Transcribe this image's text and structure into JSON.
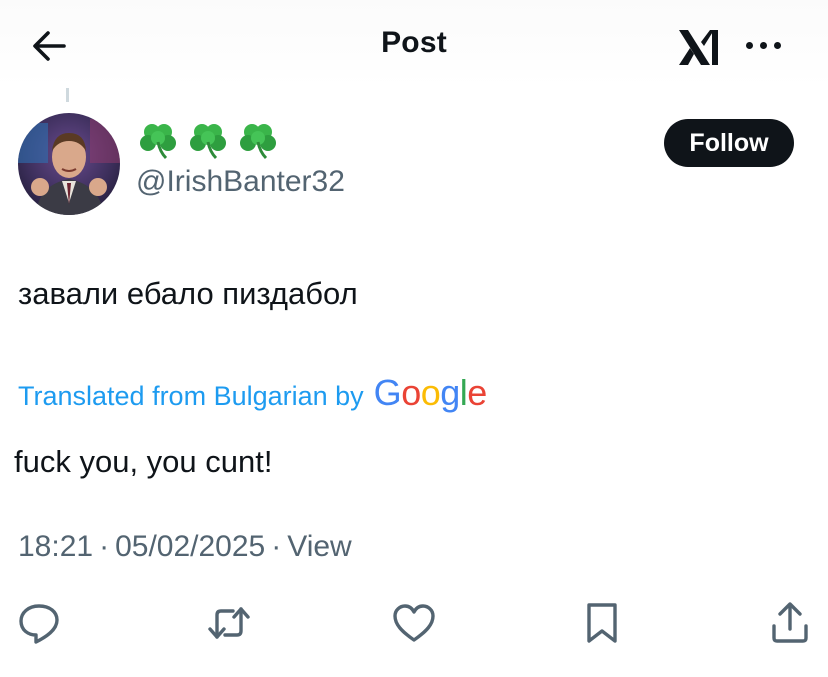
{
  "header": {
    "title": "Post",
    "back_icon": "arrow-left-icon",
    "logo_icon": "xai-logo-icon",
    "more_icon": "more-dots-icon"
  },
  "author": {
    "display_name_emojis": [
      "☘️",
      "☘️",
      "☘️"
    ],
    "handle": "@IrishBanter32",
    "follow_label": "Follow"
  },
  "post": {
    "text": "завали ебало пиздабол",
    "translated_label": "Translated from Bulgarian by",
    "translator_brand": "Google",
    "translation": "fuck you, you cunt!",
    "time": "18:21",
    "date": "05/02/2025",
    "separator": "·",
    "views_label": "View"
  },
  "actions": {
    "icons": [
      "reply-icon",
      "retweet-icon",
      "like-icon",
      "bookmark-icon",
      "share-icon"
    ]
  },
  "colors": {
    "text": "#0f1419",
    "secondary": "#536471",
    "link": "#1d9bf0",
    "button_bg": "#0f1419"
  }
}
